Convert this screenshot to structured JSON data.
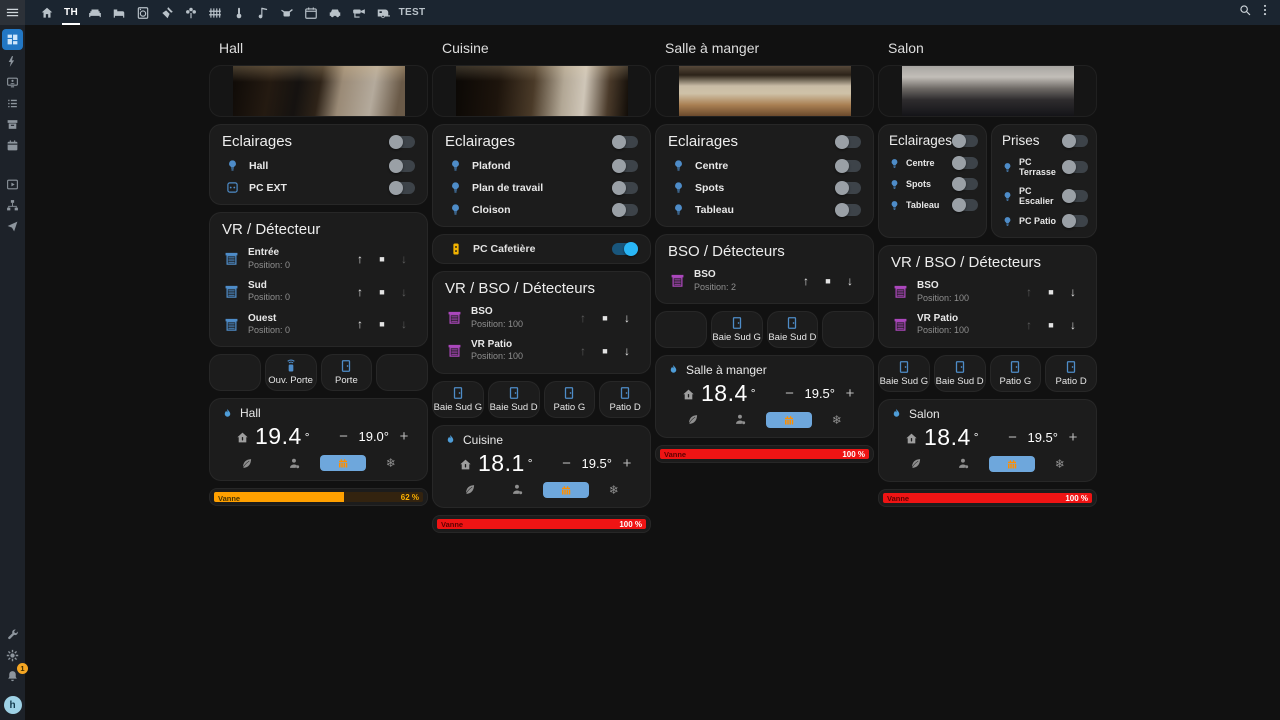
{
  "topbar": {
    "tabs": [
      {
        "icon": "home"
      },
      {
        "icon": "floorplan",
        "label": "TH",
        "selected": true
      },
      {
        "icon": "sofa"
      },
      {
        "icon": "bed"
      },
      {
        "icon": "washing-machine"
      },
      {
        "icon": "shovel"
      },
      {
        "icon": "flower"
      },
      {
        "icon": "fence"
      },
      {
        "icon": "thermometer"
      },
      {
        "icon": "music"
      },
      {
        "icon": "watering-can"
      },
      {
        "icon": "calendar-clock"
      },
      {
        "icon": "car"
      },
      {
        "icon": "cctv"
      },
      {
        "icon": "caravan"
      },
      {
        "label": "TEST"
      }
    ]
  },
  "sidebar": {
    "groups": [
      [
        {
          "icon": "dashboard",
          "selected": true
        },
        {
          "icon": "energy"
        },
        {
          "icon": "media-display"
        },
        {
          "icon": "list"
        },
        {
          "icon": "archive"
        },
        {
          "icon": "calendar"
        }
      ],
      [
        {
          "icon": "media-box"
        },
        {
          "icon": "sitemap"
        },
        {
          "icon": "send"
        }
      ]
    ],
    "bottom": [
      {
        "icon": "tools"
      },
      {
        "icon": "settings"
      }
    ],
    "notification_count": "1",
    "user_initial": "h"
  },
  "ui": {
    "minus": "−",
    "plus": "+",
    "up": "↑",
    "stop": "■",
    "down": "↓",
    "snowflake": "❄",
    "presets": [
      {
        "icon": "leaf"
      },
      {
        "icon": "person"
      },
      {
        "icon": "radiator",
        "selected": true
      },
      {
        "icon": "snowflake"
      }
    ]
  },
  "colors": {
    "toggle_on": "#29b6f6",
    "cover_blue": "#4e8cc8",
    "cover_purple": "#ab47bc",
    "bulb": "#4e8cc8",
    "tile_icon": "#4e8cc8",
    "valve_orange": "#ffa000",
    "valve_red": "#ef1414",
    "preset_selected": "#6ea7dc",
    "radiator": "#ff8f00",
    "flame": "#4e9dd8",
    "amber_socket": "#f2b300"
  },
  "columns": [
    {
      "title": "Hall",
      "camera": "hall",
      "sections": [
        {
          "type": "lights",
          "header": "Eclairages",
          "header_toggle": false,
          "rows": [
            {
              "icon": "bulb",
              "label": "Hall",
              "on": false
            },
            {
              "icon": "outlet",
              "label": "PC EXT",
              "on": false
            }
          ]
        },
        {
          "type": "covers",
          "header": "VR / Détecteur",
          "color": "blue",
          "rows": [
            {
              "name": "Entrée",
              "position": "Position: 0",
              "up": true,
              "down": false
            },
            {
              "name": "Sud",
              "position": "Position: 0",
              "up": true,
              "down": false
            },
            {
              "name": "Ouest",
              "position": "Position: 0",
              "up": true,
              "down": false
            }
          ]
        },
        {
          "type": "tiles",
          "items": [
            {
              "empty": true
            },
            {
              "icon": "remote",
              "label": "Ouv. Porte"
            },
            {
              "icon": "door",
              "label": "Porte"
            },
            {
              "empty": true
            }
          ]
        },
        {
          "type": "climate",
          "name": "Hall",
          "current": "19.4",
          "degree": "°",
          "target": "19.0°"
        },
        {
          "type": "valve",
          "label": "Vanne",
          "value": "62 %",
          "percent": 62,
          "color": "orange"
        }
      ]
    },
    {
      "title": "Cuisine",
      "camera": "cuisine",
      "sections": [
        {
          "type": "lights",
          "header": "Eclairages",
          "header_toggle": false,
          "rows": [
            {
              "icon": "bulb",
              "label": "Plafond",
              "on": false
            },
            {
              "icon": "bulb",
              "label": "Plan de travail",
              "on": false
            },
            {
              "icon": "bulb",
              "label": "Cloison",
              "on": false
            }
          ]
        },
        {
          "type": "switch",
          "icon": "socket",
          "label": "PC Cafetière",
          "on": true
        },
        {
          "type": "covers",
          "header": "VR / BSO / Détecteurs",
          "color": "purple",
          "rows": [
            {
              "name": "BSO",
              "position": "Position: 100",
              "up": false,
              "down": true
            },
            {
              "name": "VR Patio",
              "position": "Position: 100",
              "up": false,
              "down": true
            }
          ]
        },
        {
          "type": "tiles",
          "items": [
            {
              "icon": "door",
              "label": "Baie Sud G"
            },
            {
              "icon": "door",
              "label": "Baie Sud D"
            },
            {
              "icon": "door",
              "label": "Patio G"
            },
            {
              "icon": "door",
              "label": "Patio D"
            }
          ]
        },
        {
          "type": "climate",
          "name": "Cuisine",
          "current": "18.1",
          "degree": "°",
          "target": "19.5°"
        },
        {
          "type": "valve",
          "label": "Vanne",
          "value": "100 %",
          "percent": 100,
          "color": "red"
        }
      ]
    },
    {
      "title": "Salle à manger",
      "camera": "salle",
      "sections": [
        {
          "type": "lights",
          "header": "Eclairages",
          "header_toggle": false,
          "rows": [
            {
              "icon": "bulb",
              "label": "Centre",
              "on": false
            },
            {
              "icon": "bulb",
              "label": "Spots",
              "on": false
            },
            {
              "icon": "bulb",
              "label": "Tableau",
              "on": false
            }
          ]
        },
        {
          "type": "covers",
          "header": "BSO / Détecteurs",
          "color": "purple",
          "rows": [
            {
              "name": "BSO",
              "position": "Position: 2",
              "up": true,
              "down": true
            }
          ]
        },
        {
          "type": "tiles",
          "items": [
            {
              "empty": true
            },
            {
              "icon": "door",
              "label": "Baie Sud G"
            },
            {
              "icon": "door",
              "label": "Baie Sud D"
            },
            {
              "empty": true
            }
          ]
        },
        {
          "type": "climate",
          "name": "Salle à manger",
          "current": "18.4",
          "degree": "°",
          "target": "19.5°"
        },
        {
          "type": "valve",
          "label": "Vanne",
          "value": "100 %",
          "percent": 100,
          "color": "red"
        }
      ]
    },
    {
      "title": "Salon",
      "camera": "salon",
      "sections": [
        {
          "type": "pair",
          "cards": [
            {
              "header": "Eclairages",
              "header_toggle": false,
              "rows": [
                {
                  "icon": "bulb",
                  "label": "Centre",
                  "on": false
                },
                {
                  "icon": "bulb",
                  "label": "Spots",
                  "on": false
                },
                {
                  "icon": "bulb",
                  "label": "Tableau",
                  "on": false
                }
              ]
            },
            {
              "header": "Prises",
              "header_toggle": false,
              "rows": [
                {
                  "icon": "bulb",
                  "label": "PC Terrasse",
                  "on": false
                },
                {
                  "icon": "bulb",
                  "label": "PC Escalier",
                  "on": false
                },
                {
                  "icon": "bulb",
                  "label": "PC Patio",
                  "on": false
                }
              ]
            }
          ]
        },
        {
          "type": "covers",
          "header": "VR / BSO / Détecteurs",
          "color": "purple",
          "rows": [
            {
              "name": "BSO",
              "position": "Position: 100",
              "up": false,
              "down": true
            },
            {
              "name": "VR Patio",
              "position": "Position: 100",
              "up": false,
              "down": true
            }
          ]
        },
        {
          "type": "tiles",
          "items": [
            {
              "icon": "door",
              "label": "Baie Sud G"
            },
            {
              "icon": "door",
              "label": "Baie Sud D"
            },
            {
              "icon": "door",
              "label": "Patio G"
            },
            {
              "icon": "door",
              "label": "Patio D"
            }
          ]
        },
        {
          "type": "climate",
          "name": "Salon",
          "current": "18.4",
          "degree": "°",
          "target": "19.5°"
        },
        {
          "type": "valve",
          "label": "Vanne",
          "value": "100 %",
          "percent": 100,
          "color": "red"
        }
      ]
    }
  ]
}
